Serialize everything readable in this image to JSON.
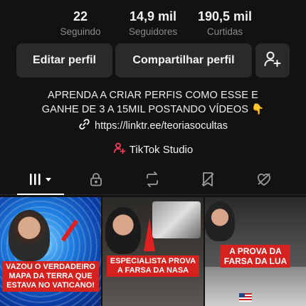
{
  "stats": [
    {
      "value": "22",
      "label": "Seguindo"
    },
    {
      "value": "14,9 mil",
      "label": "Seguidores"
    },
    {
      "value": "190,5 mil",
      "label": "Curtidas"
    }
  ],
  "actions": {
    "edit_label": "Editar perfil",
    "share_label": "Compartilhar perfil",
    "add_friend_icon": "add-user-icon"
  },
  "bio": {
    "line1": "APRENDA A CRIAR PERFIS COMO ESSE E",
    "line2": "GANHE DE 3 A 15MIL POSTANDO VÍDEOS 👇",
    "link": "https://linktr.ee/teoriasocultas",
    "studio": "TikTok Studio"
  },
  "tabs": [
    {
      "name": "videos",
      "icon": "grid-icon",
      "active": true
    },
    {
      "name": "private",
      "icon": "lock-icon"
    },
    {
      "name": "reposts",
      "icon": "repost-icon"
    },
    {
      "name": "favorites",
      "icon": "bookmark-icon"
    },
    {
      "name": "liked",
      "icon": "heart-icon"
    }
  ],
  "videos": [
    {
      "caption_l1": "VAZOU O VERDADEIRO",
      "caption_l2": "MAPA DA TERRA QUE",
      "caption_l3": "ESTAVA NO VATICANO!"
    },
    {
      "caption_l1": "ESPECIALISTA PROVA",
      "caption_l2": "A FARSA DA NASA"
    },
    {
      "caption_l1": "A PROVA DA",
      "caption_l2": "FARSA DA LUA"
    }
  ],
  "colors": {
    "background": "#121212",
    "button_bg": "#2a2a2a",
    "accent_pink": "#ff3b5c",
    "caption_red": "#d6221e"
  }
}
